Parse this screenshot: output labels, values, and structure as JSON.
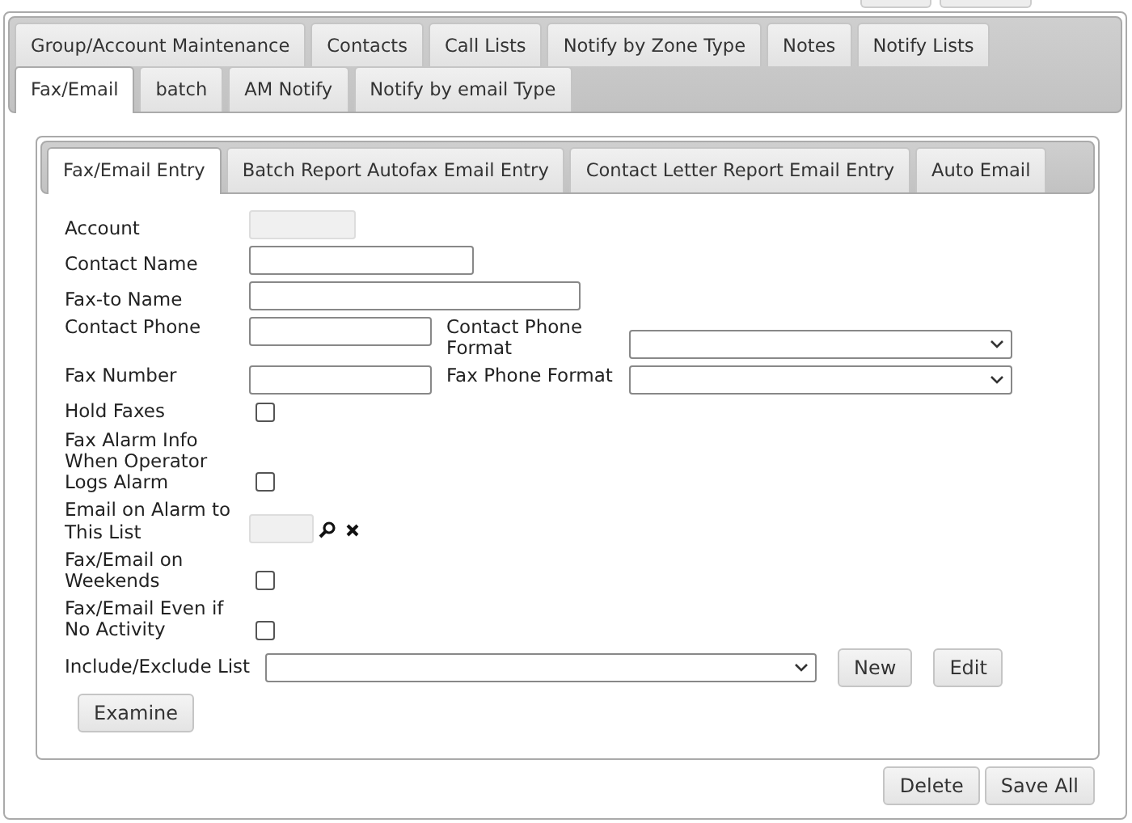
{
  "outer_tabs": [
    {
      "label": "Group/Account Maintenance",
      "selected": false
    },
    {
      "label": "Contacts",
      "selected": false
    },
    {
      "label": "Call Lists",
      "selected": false
    },
    {
      "label": "Notify by Zone Type",
      "selected": false
    },
    {
      "label": "Notes",
      "selected": false
    },
    {
      "label": "Notify Lists",
      "selected": false
    },
    {
      "label": "Fax/Email",
      "selected": true
    },
    {
      "label": "batch",
      "selected": false
    },
    {
      "label": "AM Notify",
      "selected": false
    },
    {
      "label": "Notify by email Type",
      "selected": false
    }
  ],
  "inner_tabs": [
    {
      "label": "Fax/Email Entry",
      "selected": true
    },
    {
      "label": "Batch Report Autofax Email Entry",
      "selected": false
    },
    {
      "label": "Contact Letter Report Email Entry",
      "selected": false
    },
    {
      "label": "Auto Email",
      "selected": false
    }
  ],
  "fields": [
    {
      "kind": "text",
      "label": "Account",
      "disabled": true
    },
    {
      "kind": "text",
      "label": "Contact Name",
      "disabled": false
    },
    {
      "kind": "text",
      "label": "Fax-to Name",
      "disabled": false
    },
    {
      "kind": "text",
      "label": "Contact Phone",
      "disabled": false,
      "format_label": "Contact Phone Format"
    },
    {
      "kind": "text",
      "label": "Fax Number",
      "disabled": false,
      "format_label": "Fax Phone Format"
    },
    {
      "kind": "checkbox",
      "label": "Hold Faxes",
      "checked": false
    },
    {
      "kind": "checkbox",
      "label": "Fax Alarm Info When Operator Logs Alarm",
      "checked": false
    },
    {
      "kind": "lookup",
      "label": "Email on Alarm to This List"
    },
    {
      "kind": "checkbox",
      "label": "Fax/Email on Weekends",
      "checked": false
    },
    {
      "kind": "checkbox",
      "label": "Fax/Email Even if No Activity",
      "checked": false
    },
    {
      "kind": "select",
      "label": "Include/Exclude List",
      "buttons": [
        "New",
        "Edit"
      ]
    }
  ],
  "examine_button": "Examine",
  "footer_buttons": [
    "Delete",
    "Save All"
  ]
}
